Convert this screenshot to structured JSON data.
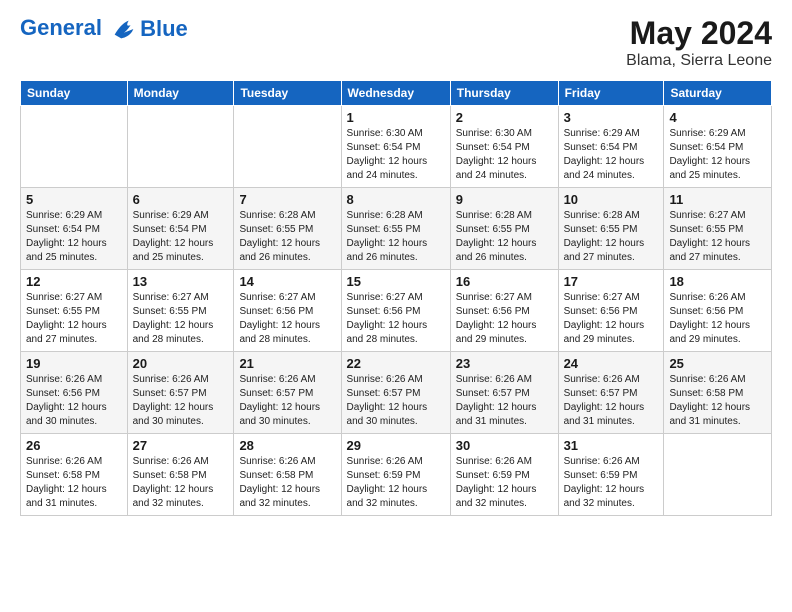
{
  "header": {
    "logo_line1": "General",
    "logo_line2": "Blue",
    "month_year": "May 2024",
    "location": "Blama, Sierra Leone"
  },
  "weekdays": [
    "Sunday",
    "Monday",
    "Tuesday",
    "Wednesday",
    "Thursday",
    "Friday",
    "Saturday"
  ],
  "weeks": [
    [
      {
        "day": "",
        "info": ""
      },
      {
        "day": "",
        "info": ""
      },
      {
        "day": "",
        "info": ""
      },
      {
        "day": "1",
        "info": "Sunrise: 6:30 AM\nSunset: 6:54 PM\nDaylight: 12 hours\nand 24 minutes."
      },
      {
        "day": "2",
        "info": "Sunrise: 6:30 AM\nSunset: 6:54 PM\nDaylight: 12 hours\nand 24 minutes."
      },
      {
        "day": "3",
        "info": "Sunrise: 6:29 AM\nSunset: 6:54 PM\nDaylight: 12 hours\nand 24 minutes."
      },
      {
        "day": "4",
        "info": "Sunrise: 6:29 AM\nSunset: 6:54 PM\nDaylight: 12 hours\nand 25 minutes."
      }
    ],
    [
      {
        "day": "5",
        "info": "Sunrise: 6:29 AM\nSunset: 6:54 PM\nDaylight: 12 hours\nand 25 minutes."
      },
      {
        "day": "6",
        "info": "Sunrise: 6:29 AM\nSunset: 6:54 PM\nDaylight: 12 hours\nand 25 minutes."
      },
      {
        "day": "7",
        "info": "Sunrise: 6:28 AM\nSunset: 6:55 PM\nDaylight: 12 hours\nand 26 minutes."
      },
      {
        "day": "8",
        "info": "Sunrise: 6:28 AM\nSunset: 6:55 PM\nDaylight: 12 hours\nand 26 minutes."
      },
      {
        "day": "9",
        "info": "Sunrise: 6:28 AM\nSunset: 6:55 PM\nDaylight: 12 hours\nand 26 minutes."
      },
      {
        "day": "10",
        "info": "Sunrise: 6:28 AM\nSunset: 6:55 PM\nDaylight: 12 hours\nand 27 minutes."
      },
      {
        "day": "11",
        "info": "Sunrise: 6:27 AM\nSunset: 6:55 PM\nDaylight: 12 hours\nand 27 minutes."
      }
    ],
    [
      {
        "day": "12",
        "info": "Sunrise: 6:27 AM\nSunset: 6:55 PM\nDaylight: 12 hours\nand 27 minutes."
      },
      {
        "day": "13",
        "info": "Sunrise: 6:27 AM\nSunset: 6:55 PM\nDaylight: 12 hours\nand 28 minutes."
      },
      {
        "day": "14",
        "info": "Sunrise: 6:27 AM\nSunset: 6:56 PM\nDaylight: 12 hours\nand 28 minutes."
      },
      {
        "day": "15",
        "info": "Sunrise: 6:27 AM\nSunset: 6:56 PM\nDaylight: 12 hours\nand 28 minutes."
      },
      {
        "day": "16",
        "info": "Sunrise: 6:27 AM\nSunset: 6:56 PM\nDaylight: 12 hours\nand 29 minutes."
      },
      {
        "day": "17",
        "info": "Sunrise: 6:27 AM\nSunset: 6:56 PM\nDaylight: 12 hours\nand 29 minutes."
      },
      {
        "day": "18",
        "info": "Sunrise: 6:26 AM\nSunset: 6:56 PM\nDaylight: 12 hours\nand 29 minutes."
      }
    ],
    [
      {
        "day": "19",
        "info": "Sunrise: 6:26 AM\nSunset: 6:56 PM\nDaylight: 12 hours\nand 30 minutes."
      },
      {
        "day": "20",
        "info": "Sunrise: 6:26 AM\nSunset: 6:57 PM\nDaylight: 12 hours\nand 30 minutes."
      },
      {
        "day": "21",
        "info": "Sunrise: 6:26 AM\nSunset: 6:57 PM\nDaylight: 12 hours\nand 30 minutes."
      },
      {
        "day": "22",
        "info": "Sunrise: 6:26 AM\nSunset: 6:57 PM\nDaylight: 12 hours\nand 30 minutes."
      },
      {
        "day": "23",
        "info": "Sunrise: 6:26 AM\nSunset: 6:57 PM\nDaylight: 12 hours\nand 31 minutes."
      },
      {
        "day": "24",
        "info": "Sunrise: 6:26 AM\nSunset: 6:57 PM\nDaylight: 12 hours\nand 31 minutes."
      },
      {
        "day": "25",
        "info": "Sunrise: 6:26 AM\nSunset: 6:58 PM\nDaylight: 12 hours\nand 31 minutes."
      }
    ],
    [
      {
        "day": "26",
        "info": "Sunrise: 6:26 AM\nSunset: 6:58 PM\nDaylight: 12 hours\nand 31 minutes."
      },
      {
        "day": "27",
        "info": "Sunrise: 6:26 AM\nSunset: 6:58 PM\nDaylight: 12 hours\nand 32 minutes."
      },
      {
        "day": "28",
        "info": "Sunrise: 6:26 AM\nSunset: 6:58 PM\nDaylight: 12 hours\nand 32 minutes."
      },
      {
        "day": "29",
        "info": "Sunrise: 6:26 AM\nSunset: 6:59 PM\nDaylight: 12 hours\nand 32 minutes."
      },
      {
        "day": "30",
        "info": "Sunrise: 6:26 AM\nSunset: 6:59 PM\nDaylight: 12 hours\nand 32 minutes."
      },
      {
        "day": "31",
        "info": "Sunrise: 6:26 AM\nSunset: 6:59 PM\nDaylight: 12 hours\nand 32 minutes."
      },
      {
        "day": "",
        "info": ""
      }
    ]
  ]
}
